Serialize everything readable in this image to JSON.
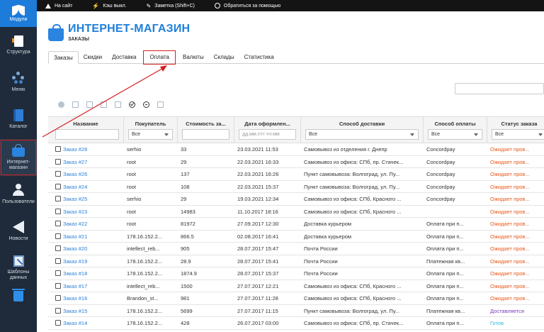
{
  "sidebar": {
    "logo_label": "Модули",
    "items": [
      {
        "label": "Структура",
        "icon": "structure-icon"
      },
      {
        "label": "Меню",
        "icon": "menu-icon"
      },
      {
        "label": "Каталог",
        "icon": "catalog-icon"
      },
      {
        "label": "Интернет-\nмагазин",
        "icon": "shop-bag-icon",
        "active": true
      },
      {
        "label": "Пользователи",
        "icon": "users-icon"
      },
      {
        "label": "Новости",
        "icon": "news-icon"
      },
      {
        "label": "Шаблоны\nданных",
        "icon": "templates-icon"
      },
      {
        "label": "",
        "icon": "trash-icon"
      }
    ]
  },
  "topbar": {
    "site": "На сайт",
    "cache": "Кэш выкл.",
    "note": "Заметка (Shift+C)",
    "help": "Обратиться за помощью"
  },
  "header": {
    "title": "ИНТЕРНЕТ-МАГАЗИН",
    "subtitle": "ЗАКАЗЫ"
  },
  "tabs": [
    "Заказы",
    "Скидки",
    "Доставка",
    "Оплата",
    "Валюты",
    "Склады",
    "Статистика"
  ],
  "table": {
    "columns": [
      "Название",
      "Покупатель",
      "Стоимость за...",
      "Дата оформлен...",
      "Способ доставки",
      "Способ оплаты",
      "Статус заказа"
    ],
    "filters": {
      "customer": "Все",
      "date_placeholder": "дд.мм.гггг чч:мм",
      "delivery": "Все",
      "payment": "Все",
      "status": "Все"
    },
    "rows": [
      {
        "name": "Заказ #28",
        "customer": "serhio",
        "cost": "33",
        "date": "23.03.2021 11:53",
        "delivery": "Самовывоз из отделения г. Днепр",
        "payment": "Concordpay",
        "status": "Ожидает пров...",
        "st": "wait"
      },
      {
        "name": "Заказ #27",
        "customer": "root",
        "cost": "29",
        "date": "22.03.2021 16:33",
        "delivery": "Самовывоз из офиса: СПб, пр. Стачек...",
        "payment": "Concordpay",
        "status": "Ожидает пров...",
        "st": "wait"
      },
      {
        "name": "Заказ #26",
        "customer": "root",
        "cost": "137",
        "date": "22.03.2021 16:26",
        "delivery": "Пункт самовывоза: Волгоград, ул. Пу...",
        "payment": "Concordpay",
        "status": "Ожидает пров...",
        "st": "wait"
      },
      {
        "name": "Заказ #24",
        "customer": "root",
        "cost": "108",
        "date": "22.03.2021 15:37",
        "delivery": "Пункт самовывоза: Волгоград, ул. Пу...",
        "payment": "Concordpay",
        "status": "Ожидает пров...",
        "st": "wait"
      },
      {
        "name": "Заказ #25",
        "customer": "serhio",
        "cost": "29",
        "date": "19.03.2021 12:34",
        "delivery": "Самовывоз из офиса: СПб, Красного ...",
        "payment": "Concordpay",
        "status": "Ожидает пров...",
        "st": "wait"
      },
      {
        "name": "Заказ #23",
        "customer": "root",
        "cost": "14983",
        "date": "11.10.2017 18:16",
        "delivery": "Самовывоз из офиса: СПб, Красного ...",
        "payment": "",
        "status": "Ожидает пров...",
        "st": "wait"
      },
      {
        "name": "Заказ #22",
        "customer": "root",
        "cost": "81972",
        "date": "27.09.2017 12:30",
        "delivery": "Доставка курьером",
        "payment": "Оплата при п...",
        "status": "Ожидает пров...",
        "st": "wait"
      },
      {
        "name": "Заказ #21",
        "customer": "178.16.152.2...",
        "cost": "866.5",
        "date": "02.08.2017 16:41",
        "delivery": "Доставка курьером",
        "payment": "Оплата при п...",
        "status": "Ожидает пров...",
        "st": "wait"
      },
      {
        "name": "Заказ #20",
        "customer": "intellect_reb...",
        "cost": "905",
        "date": "28.07.2017 15:47",
        "delivery": "Почта России",
        "payment": "Оплата при п...",
        "status": "Ожидает пров...",
        "st": "wait"
      },
      {
        "name": "Заказ #19",
        "customer": "178.16.152.2...",
        "cost": "28.9",
        "date": "28.07.2017 15:41",
        "delivery": "Почта России",
        "payment": "Платежная кв...",
        "status": "Ожидает пров...",
        "st": "wait"
      },
      {
        "name": "Заказ #18",
        "customer": "178.16.152.2...",
        "cost": "1874.9",
        "date": "28.07.2017 15:37",
        "delivery": "Почта России",
        "payment": "Оплата при п...",
        "status": "Ожидает пров...",
        "st": "wait"
      },
      {
        "name": "Заказ #17",
        "customer": "intellect_reb...",
        "cost": "1500",
        "date": "27.07.2017 12:21",
        "delivery": "Самовывоз из офиса: СПб, Красного ...",
        "payment": "Оплата при п...",
        "status": "Ожидает пров...",
        "st": "wait"
      },
      {
        "name": "Заказ #16",
        "customer": "Brandon_st...",
        "cost": "981",
        "date": "27.07.2017 11:28",
        "delivery": "Самовывоз из офиса: СПб, Красного ...",
        "payment": "Оплата при п...",
        "status": "Ожидает пров...",
        "st": "wait"
      },
      {
        "name": "Заказ #15",
        "customer": "178.16.152.2...",
        "cost": "5699",
        "date": "27.07.2017 11:15",
        "delivery": "Пункт самовывоза: Волгоград, ул. Пу...",
        "payment": "Платежная кв...",
        "status": "Доставляется",
        "st": "del"
      },
      {
        "name": "Заказ #14",
        "customer": "178.16.152.2...",
        "cost": "428",
        "date": "26.07.2017 03:00",
        "delivery": "Самовывоз из офиса: СПб, пр. Стачек...",
        "payment": "Оплата при п...",
        "status": "Готов",
        "st": "ready"
      }
    ]
  },
  "colors": {
    "accent": "#1f7fd9",
    "sidebar_bg": "#1f2b3a",
    "topbar_bg": "#141414",
    "status_waiting": "#e8581c",
    "status_delivering": "#7a3dc0",
    "status_ready": "#2fb6d8",
    "annotation": "#d62020"
  }
}
